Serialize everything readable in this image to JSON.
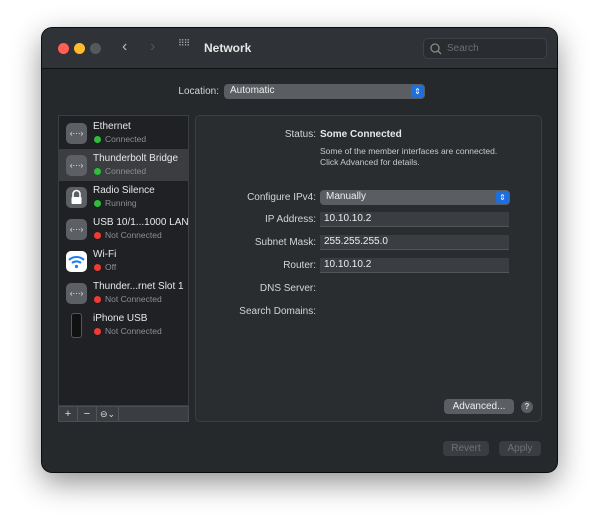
{
  "window": {
    "title": "Network",
    "search_placeholder": "Search"
  },
  "location": {
    "label": "Location:",
    "value": "Automatic"
  },
  "services": [
    {
      "name": "Ethernet",
      "status": "Connected",
      "status_color": "#2ebd3a",
      "icon": "ethernet-icon"
    },
    {
      "name": "Thunderbolt Bridge",
      "status": "Connected",
      "status_color": "#2ebd3a",
      "icon": "ethernet-icon",
      "selected": true
    },
    {
      "name": "Radio Silence",
      "status": "Running",
      "status_color": "#2ebd3a",
      "icon": "lock-icon"
    },
    {
      "name": "USB 10/1...1000 LAN",
      "status": "Not Connected",
      "status_color": "#ee3b33",
      "icon": "ethernet-icon"
    },
    {
      "name": "Wi-Fi",
      "status": "Off",
      "status_color": "#ee3b33",
      "icon": "wifi-icon"
    },
    {
      "name": "Thunder...rnet Slot 1",
      "status": "Not Connected",
      "status_color": "#ee3b33",
      "icon": "ethernet-icon"
    },
    {
      "name": "iPhone USB",
      "status": "Not Connected",
      "status_color": "#ee3b33",
      "icon": "iphone-icon"
    }
  ],
  "sidebar_buttons": {
    "add": "+",
    "remove": "−",
    "action": "⊖⌄"
  },
  "details": {
    "status_label": "Status:",
    "status_value": "Some Connected",
    "status_desc_1": "Some of the member interfaces are connected.",
    "status_desc_2": "Click Advanced for details.",
    "configure_label": "Configure IPv4:",
    "configure_value": "Manually",
    "ip_label": "IP Address:",
    "ip_value": "10.10.10.2",
    "subnet_label": "Subnet Mask:",
    "subnet_value": "255.255.255.0",
    "router_label": "Router:",
    "router_value": "10.10.10.2",
    "dns_label": "DNS Server:",
    "search_domains_label": "Search Domains:"
  },
  "buttons": {
    "advanced": "Advanced...",
    "help": "?",
    "revert": "Revert",
    "apply": "Apply"
  }
}
